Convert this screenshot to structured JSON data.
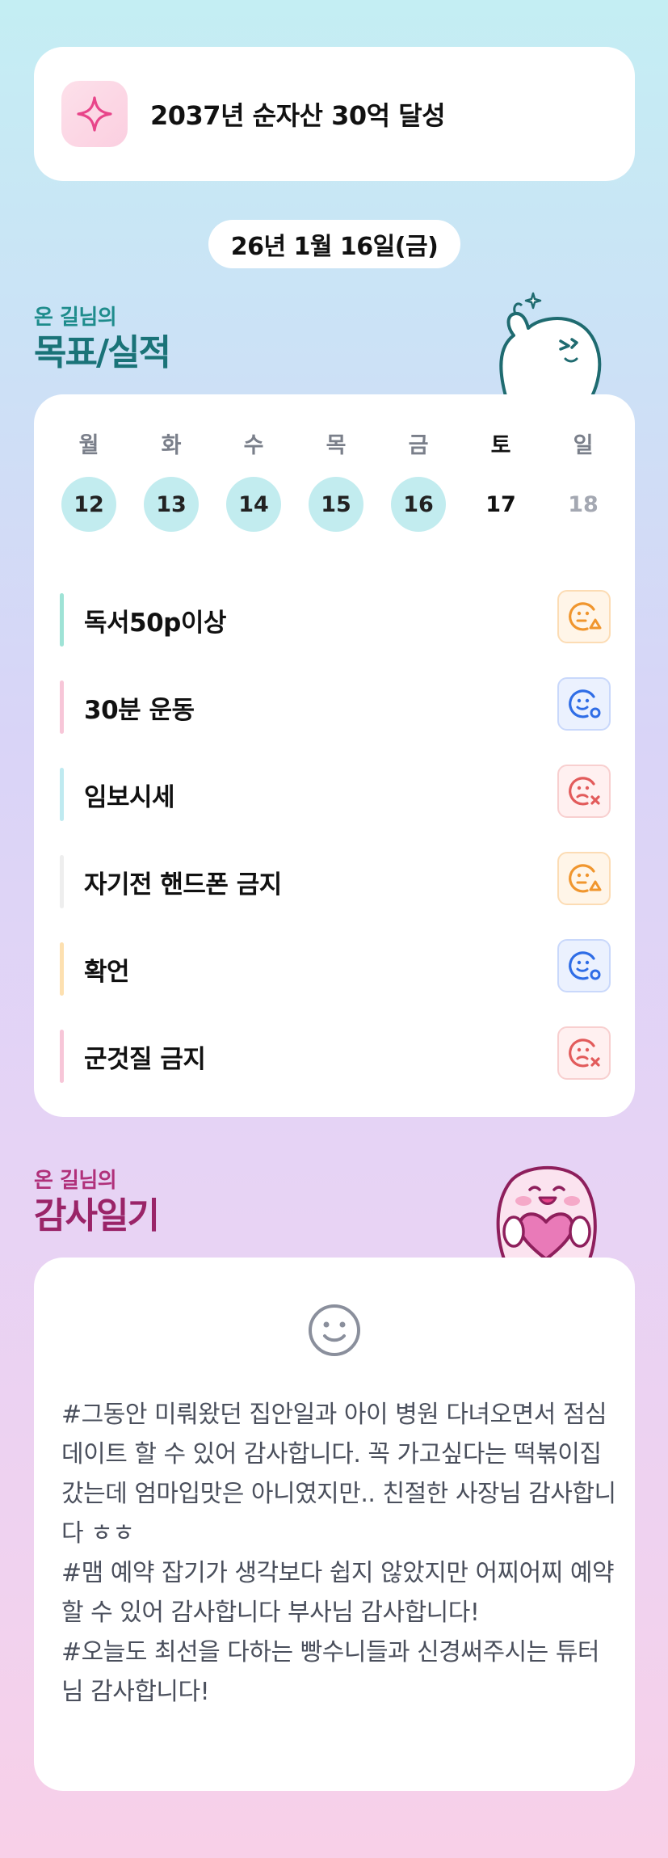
{
  "goal": {
    "title": "2037년 순자산 30억 달성",
    "icon": "sparkle-icon"
  },
  "date_pill": "26년 1월 16일(금)",
  "goals_section": {
    "subtitle": "온 길님의",
    "title": "목표/실적"
  },
  "week": [
    {
      "day": "월",
      "date": "12",
      "state": "done"
    },
    {
      "day": "화",
      "date": "13",
      "state": "done"
    },
    {
      "day": "수",
      "date": "14",
      "state": "done"
    },
    {
      "day": "목",
      "date": "15",
      "state": "done"
    },
    {
      "day": "금",
      "date": "16",
      "state": "done"
    },
    {
      "day": "토",
      "date": "17",
      "state": "today"
    },
    {
      "day": "일",
      "date": "18",
      "state": "future"
    }
  ],
  "goals": [
    {
      "label": "독서50p이상",
      "bar_color": "#9fe3d6",
      "status": "partial",
      "status_icon": "face-triangle-icon"
    },
    {
      "label": "30분 운동",
      "bar_color": "#f7c6d8",
      "status": "achieved",
      "status_icon": "face-circle-icon"
    },
    {
      "label": "임보시세",
      "bar_color": "#bfeaf0",
      "status": "failed",
      "status_icon": "face-x-icon"
    },
    {
      "label": "자기전 핸드폰 금지",
      "bar_color": "#eeeeee",
      "status": "partial",
      "status_icon": "face-triangle-icon"
    },
    {
      "label": "확언",
      "bar_color": "#fde0b0",
      "status": "achieved",
      "status_icon": "face-circle-icon"
    },
    {
      "label": "군것질 금지",
      "bar_color": "#f7c6d8",
      "status": "failed",
      "status_icon": "face-x-icon"
    }
  ],
  "colors": {
    "partial": "#f0962e",
    "achieved": "#2f6de6",
    "failed": "#e25b5b",
    "done_day": "#c2ecef"
  },
  "thanks_section": {
    "subtitle": "온 길님의",
    "title": "감사일기"
  },
  "thanks": {
    "icon": "smile-icon",
    "text": "#그동안 미뤄왔던 집안일과 아이 병원 다녀오면서 점심데이트 할 수 있어 감사합니다. 꼭 가고싶다는 떡볶이집 갔는데 엄마입맛은 아니였지만.. 친절한 사장님 감사합니다 ㅎㅎ\n#맴 예약 잡기가 생각보다 쉽지 않았지만 어찌어찌 예약 할 수 있어 감사합니다 부사님 감사합니다!\n#오늘도 최선을 다하는 빵수니들과 신경써주시는 튜터님 감사합니다!"
  }
}
